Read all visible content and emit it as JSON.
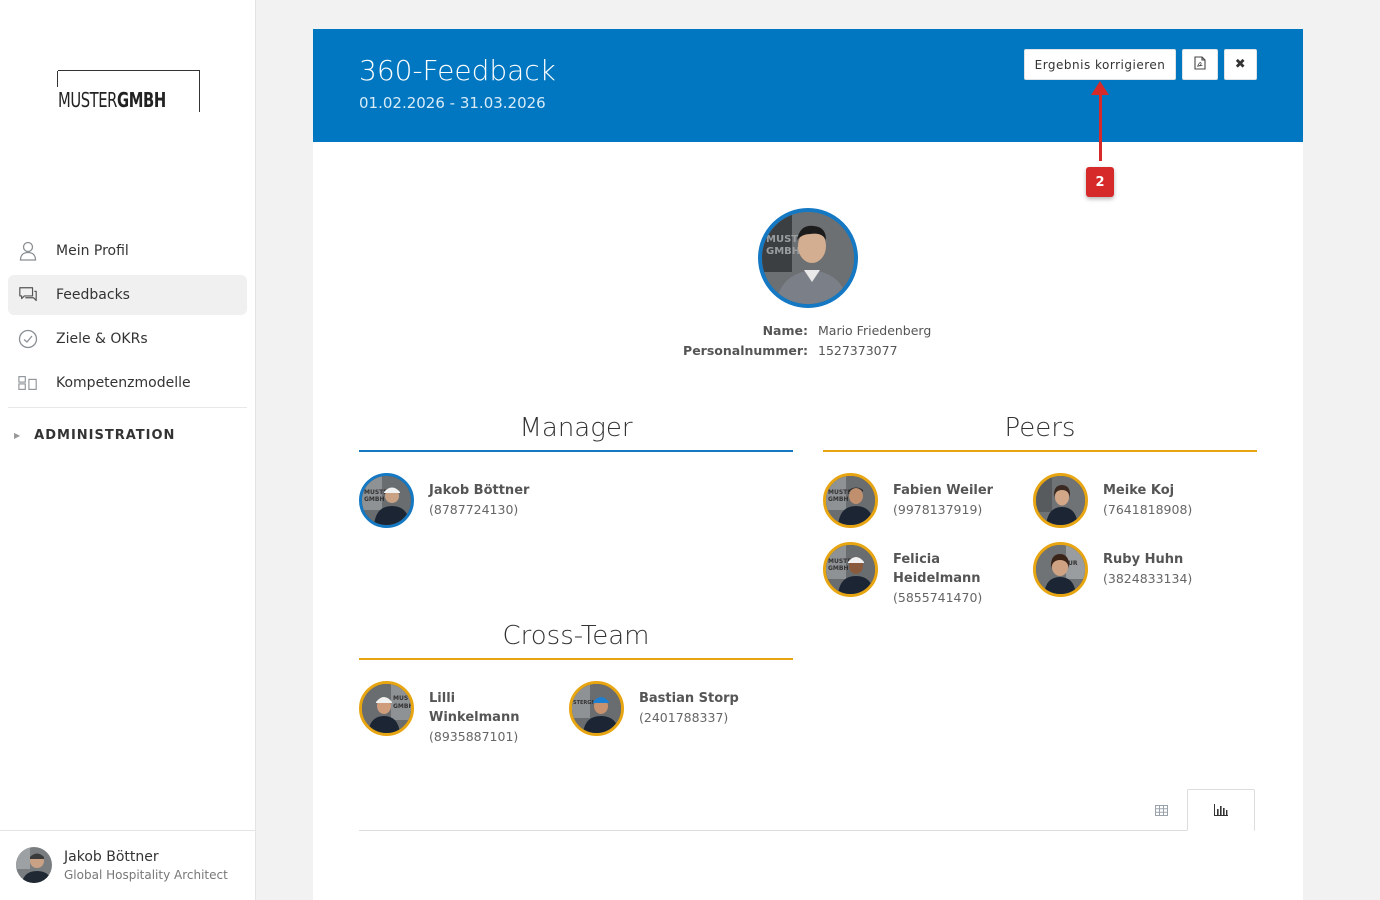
{
  "sidebar": {
    "logo": {
      "light": "MUSTER",
      "bold": "GMBH"
    },
    "items": [
      {
        "label": "Mein Profil",
        "icon": "user-icon"
      },
      {
        "label": "Feedbacks",
        "icon": "chat-icon",
        "active": true
      },
      {
        "label": "Ziele & OKRs",
        "icon": "check-circle-icon"
      },
      {
        "label": "Kompetenzmodelle",
        "icon": "model-icon"
      }
    ],
    "admin_label": "ADMINISTRATION",
    "user": {
      "name": "Jakob Böttner",
      "role": "Global Hospitality Architect"
    }
  },
  "header": {
    "title": "360-Feedback",
    "date_range": "01.02.2026 - 31.03.2026",
    "correct_button": "Ergebnis korrigieren",
    "close_button": "✖"
  },
  "annotation": {
    "badge": "2",
    "color": "#d62a2a"
  },
  "subject": {
    "name_label": "Name:",
    "name": "Mario Friedenberg",
    "id_label": "Personalnummer:",
    "id": "1527373077"
  },
  "groups": {
    "manager": {
      "title": "Manager",
      "color": "#1478c3",
      "people": [
        {
          "name": "Jakob Böttner",
          "number": "(8787724130)"
        }
      ]
    },
    "peers": {
      "title": "Peers",
      "color": "#e7a512",
      "people": [
        {
          "name": "Fabien Weiler",
          "number": "(9978137919)"
        },
        {
          "name": "Meike Koj",
          "number": "(7641818908)"
        },
        {
          "name": "Felicia Heidelmann",
          "number": "(5855741470)"
        },
        {
          "name": "Ruby Huhn",
          "number": "(3824833134)"
        }
      ]
    },
    "cross_team": {
      "title": "Cross-Team",
      "color": "#e7a512",
      "people": [
        {
          "name": "Lilli Winkelmann",
          "number": "(8935887101)"
        },
        {
          "name": "Bastian Storp",
          "number": "(2401788337)"
        }
      ]
    }
  },
  "colors": {
    "header_blue": "#0177c1",
    "accent_orange": "#e7a512",
    "accent_blue": "#1478c3"
  }
}
